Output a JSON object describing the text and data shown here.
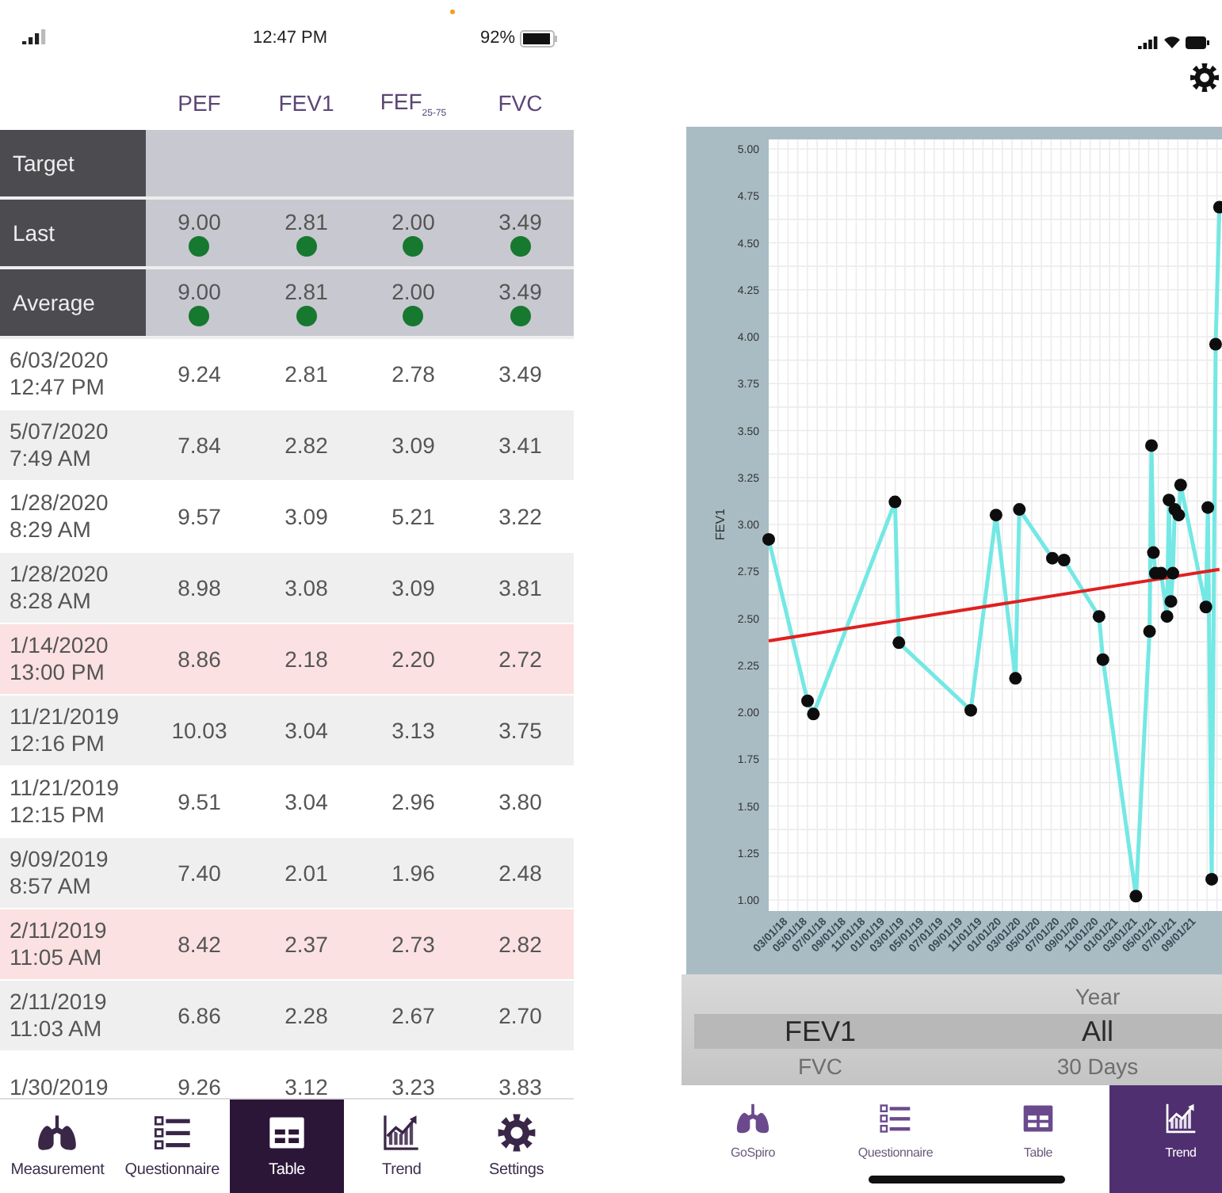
{
  "table_screen": {
    "status_bar": {
      "time": "12:47 PM",
      "battery": "92%"
    },
    "columns": [
      "PEF",
      "FEV1",
      "FEF$_{25-75}$",
      "FVC"
    ],
    "summary_rows": [
      {
        "label": "Target"
      },
      {
        "label": "Last",
        "values": [
          {
            "value": "9.00",
            "color": "#17782f"
          },
          {
            "value": "2.81",
            "color": "#17782f"
          },
          {
            "value": "2.00",
            "color": "#17782f"
          },
          {
            "value": "3.49",
            "color": "#17782f"
          }
        ]
      },
      {
        "label": "Average",
        "values": [
          {
            "value": "9.00",
            "color": "#17782f"
          },
          {
            "value": "2.81",
            "color": "#17782f"
          },
          {
            "value": "2.00",
            "color": "#17782f"
          },
          {
            "value": "3.49",
            "color": "#17782f"
          }
        ]
      }
    ],
    "rows": [
      {
        "date": "6/03/2020",
        "time": "12:47 PM",
        "values": [
          "9.24",
          "2.81",
          "2.78",
          "3.49"
        ],
        "flagged": false
      },
      {
        "date": "5/07/2020",
        "time": "7:49 AM",
        "values": [
          "7.84",
          "2.82",
          "3.09",
          "3.41"
        ],
        "flagged": false
      },
      {
        "date": "1/28/2020",
        "time": "8:29 AM",
        "values": [
          "9.57",
          "3.09",
          "5.21",
          "3.22"
        ],
        "flagged": false
      },
      {
        "date": "1/28/2020",
        "time": "8:28 AM",
        "values": [
          "8.98",
          "3.08",
          "3.09",
          "3.81"
        ],
        "flagged": false
      },
      {
        "date": "1/14/2020",
        "time": "13:00 PM",
        "values": [
          "8.86",
          "2.18",
          "2.20",
          "2.72"
        ],
        "flagged": true
      },
      {
        "date": "11/21/2019",
        "time": "12:16 PM",
        "values": [
          "10.03",
          "3.04",
          "3.13",
          "3.75"
        ],
        "flagged": false
      },
      {
        "date": "11/21/2019",
        "time": "12:15 PM",
        "values": [
          "9.51",
          "3.04",
          "2.96",
          "3.80"
        ],
        "flagged": false
      },
      {
        "date": "9/09/2019",
        "time": "8:57 AM",
        "values": [
          "7.40",
          "2.01",
          "1.96",
          "2.48"
        ],
        "flagged": false
      },
      {
        "date": "2/11/2019",
        "time": "11:05 AM",
        "values": [
          "8.42",
          "2.37",
          "2.73",
          "2.82"
        ],
        "flagged": true
      },
      {
        "date": "2/11/2019",
        "time": "11:03 AM",
        "values": [
          "6.86",
          "2.28",
          "2.67",
          "2.70"
        ],
        "flagged": false
      },
      {
        "date": "1/30/2019",
        "values": [
          "9.26",
          "3.12",
          "3.23",
          "3.83"
        ],
        "flagged": false
      }
    ],
    "tabs": [
      {
        "label": "Measurement",
        "selected": false
      },
      {
        "label": "Questionnaire",
        "selected": false
      },
      {
        "label": "Table",
        "selected": true
      },
      {
        "label": "Trend",
        "selected": false
      },
      {
        "label": "Settings",
        "selected": false
      }
    ]
  },
  "trend_screen": {
    "chart": {
      "chart_data": {
        "type": "line",
        "ylabel": "FEV1",
        "ylim": [
          1,
          5
        ],
        "grid": true,
        "yticks": [
          {
            "value": 1,
            "label": "1.00"
          },
          {
            "value": 1.25,
            "label": "1.25"
          },
          {
            "value": 1.5,
            "label": "1.50"
          },
          {
            "value": 1.75,
            "label": "1.75"
          },
          {
            "value": 2,
            "label": "2.00"
          },
          {
            "value": 2.25,
            "label": "2.25"
          },
          {
            "value": 2.5,
            "label": "2.50"
          },
          {
            "value": 2.75,
            "label": "2.75"
          },
          {
            "value": 3,
            "label": "3.00"
          },
          {
            "value": 3.25,
            "label": "3.25"
          },
          {
            "value": 3.5,
            "label": "3.50"
          },
          {
            "value": 3.75,
            "label": "3.75"
          },
          {
            "value": 4,
            "label": "4.00"
          },
          {
            "value": 4.25,
            "label": "4.25"
          },
          {
            "value": 4.5,
            "label": "4.50"
          },
          {
            "value": 4.75,
            "label": "4.75"
          },
          {
            "value": 5,
            "label": "5.00"
          }
        ],
        "categories": [
          null,
          null,
          null,
          null,
          null,
          null,
          null,
          null,
          null,
          null,
          "03/01/18",
          null,
          null,
          null,
          null,
          null,
          null,
          null,
          null,
          null,
          "05/01/18",
          null,
          null,
          null,
          null,
          null,
          null,
          null,
          null,
          null,
          "07/01/18",
          null,
          null,
          null,
          null,
          null,
          null,
          null,
          null,
          null,
          "09/01/18",
          null,
          null,
          null,
          null,
          null,
          null,
          null,
          null,
          null,
          "11/01/18",
          null,
          null,
          null,
          null,
          null,
          null,
          null,
          null,
          null,
          "01/01/19",
          null,
          null,
          null,
          null,
          null,
          null,
          null,
          null,
          null,
          "03/01/19",
          null,
          null,
          null,
          null,
          null,
          null,
          null,
          null,
          null,
          "05/01/19",
          null,
          null,
          null,
          null,
          null,
          null,
          null,
          null,
          null,
          "07/01/19",
          null,
          null,
          null,
          null,
          null,
          null,
          null,
          null,
          null,
          "09/01/19",
          null,
          null,
          null,
          null,
          null,
          null,
          null,
          null,
          null,
          "11/01/19",
          null,
          null,
          null,
          null,
          null,
          null,
          null,
          null,
          null,
          "01/01/20",
          null,
          null,
          null,
          null,
          null,
          null,
          null,
          null,
          null,
          "03/01/20",
          null,
          null,
          null,
          null,
          null,
          null,
          null,
          null,
          null,
          "05/01/20",
          null,
          null,
          null,
          null,
          null,
          null,
          null,
          null,
          null,
          "07/01/20",
          null,
          null,
          null,
          null,
          null,
          null,
          null,
          null,
          null,
          "09/01/20",
          null,
          null,
          null,
          null,
          null,
          null,
          null,
          null,
          null,
          "11/01/20",
          null,
          null,
          null,
          null,
          null,
          null,
          null,
          null,
          null,
          "01/01/21",
          null,
          null,
          null,
          null,
          null,
          null,
          null,
          null,
          null,
          "03/01/21",
          null,
          null,
          null,
          null,
          null,
          null,
          null,
          null,
          null,
          "05/01/21",
          null,
          null,
          null,
          null,
          null,
          null,
          null,
          null,
          null,
          "07/01/21",
          null,
          null,
          null,
          null,
          null,
          null,
          null,
          null,
          null,
          "09/01/21",
          null,
          null,
          null,
          null,
          null,
          null,
          null,
          null,
          null,
          null,
          null,
          null
        ],
        "series": [
          {
            "color": "#74e8e4",
            "marker": true,
            "values": [
              2.92,
              null,
              null,
              null,
              null,
              null,
              null,
              null,
              null,
              null,
              null,
              null,
              null,
              null,
              null,
              null,
              null,
              null,
              null,
              null,
              2.06,
              null,
              null,
              1.99,
              null,
              null,
              null,
              null,
              null,
              null,
              null,
              null,
              null,
              null,
              null,
              null,
              null,
              null,
              null,
              null,
              null,
              null,
              null,
              null,
              null,
              null,
              null,
              null,
              null,
              null,
              null,
              null,
              null,
              null,
              null,
              null,
              null,
              null,
              null,
              null,
              null,
              null,
              null,
              null,
              null,
              3.12,
              null,
              2.37,
              null,
              null,
              null,
              null,
              null,
              null,
              null,
              null,
              null,
              null,
              null,
              null,
              null,
              null,
              null,
              null,
              null,
              null,
              null,
              null,
              null,
              null,
              null,
              null,
              null,
              null,
              null,
              null,
              null,
              null,
              null,
              null,
              null,
              null,
              null,
              null,
              2.01,
              null,
              null,
              null,
              null,
              null,
              null,
              null,
              null,
              null,
              null,
              null,
              null,
              3.05,
              null,
              null,
              null,
              null,
              null,
              null,
              null,
              null,
              null,
              2.18,
              null,
              3.08,
              null,
              null,
              null,
              null,
              null,
              null,
              null,
              null,
              null,
              null,
              null,
              null,
              null,
              null,
              null,
              null,
              2.82,
              null,
              null,
              null,
              null,
              null,
              2.81,
              null,
              null,
              null,
              null,
              null,
              null,
              null,
              null,
              null,
              null,
              null,
              null,
              null,
              null,
              null,
              null,
              null,
              2.51,
              null,
              2.28,
              null,
              null,
              null,
              null,
              null,
              null,
              null,
              null,
              null,
              null,
              null,
              null,
              null,
              null,
              null,
              null,
              1.02,
              null,
              null,
              null,
              null,
              null,
              null,
              2.43,
              3.42,
              2.85,
              2.74,
              null,
              null,
              2.74,
              null,
              null,
              2.51,
              3.13,
              2.59,
              2.74,
              3.08,
              null,
              3.05,
              3.21,
              null,
              null,
              null,
              null,
              null,
              null,
              null,
              null,
              null,
              null,
              null,
              null,
              2.56,
              3.09,
              null,
              1.11,
              null,
              3.96,
              null,
              4.69
            ]
          },
          {
            "color": "#e02020",
            "marker": false,
            "values": [
              2.38,
              null,
              null,
              null,
              null,
              null,
              null,
              null,
              null,
              null,
              null,
              null,
              null,
              null,
              null,
              null,
              null,
              null,
              null,
              null,
              null,
              null,
              null,
              null,
              null,
              null,
              null,
              null,
              null,
              null,
              null,
              null,
              null,
              null,
              null,
              null,
              null,
              null,
              null,
              null,
              null,
              null,
              null,
              null,
              null,
              null,
              null,
              null,
              null,
              null,
              null,
              null,
              null,
              null,
              null,
              null,
              null,
              null,
              null,
              null,
              null,
              null,
              null,
              null,
              null,
              null,
              null,
              null,
              null,
              null,
              null,
              null,
              null,
              null,
              null,
              null,
              null,
              null,
              null,
              null,
              null,
              null,
              null,
              null,
              null,
              null,
              null,
              null,
              null,
              null,
              null,
              null,
              null,
              null,
              null,
              null,
              null,
              null,
              null,
              null,
              null,
              null,
              null,
              null,
              null,
              null,
              null,
              null,
              null,
              null,
              null,
              null,
              null,
              null,
              null,
              null,
              null,
              null,
              null,
              null,
              null,
              null,
              null,
              null,
              null,
              null,
              null,
              null,
              null,
              null,
              null,
              null,
              null,
              null,
              null,
              null,
              null,
              null,
              null,
              null,
              null,
              null,
              null,
              null,
              null,
              null,
              null,
              null,
              null,
              null,
              null,
              null,
              null,
              null,
              null,
              null,
              null,
              null,
              null,
              null,
              null,
              null,
              null,
              null,
              null,
              null,
              null,
              null,
              null,
              null,
              null,
              null,
              null,
              null,
              null,
              null,
              null,
              null,
              null,
              null,
              null,
              null,
              null,
              null,
              null,
              null,
              null,
              null,
              null,
              null,
              null,
              null,
              null,
              null,
              null,
              null,
              null,
              null,
              null,
              null,
              null,
              null,
              null,
              null,
              null,
              null,
              null,
              null,
              null,
              null,
              null,
              null,
              null,
              null,
              null,
              null,
              null,
              null,
              null,
              null,
              null,
              null,
              null,
              null,
              null,
              null,
              null,
              null,
              null,
              null,
              null,
              null,
              2.76
            ]
          }
        ]
      }
    },
    "picker": [
      {
        "items": [
          {
            "label": "FEV1",
            "selected": true
          },
          {
            "label": "FVC",
            "selected": false
          }
        ]
      },
      {
        "items": [
          {
            "label": "Year",
            "selected": false
          },
          {
            "label": "All",
            "selected": true
          },
          {
            "label": "30 Days",
            "selected": false
          }
        ]
      }
    ],
    "tabs": [
      {
        "label": "GoSpiro",
        "selected": false
      },
      {
        "label": "Questionnaire",
        "selected": false
      },
      {
        "label": "Table",
        "selected": false
      },
      {
        "label": "Trend",
        "selected": true
      }
    ]
  }
}
